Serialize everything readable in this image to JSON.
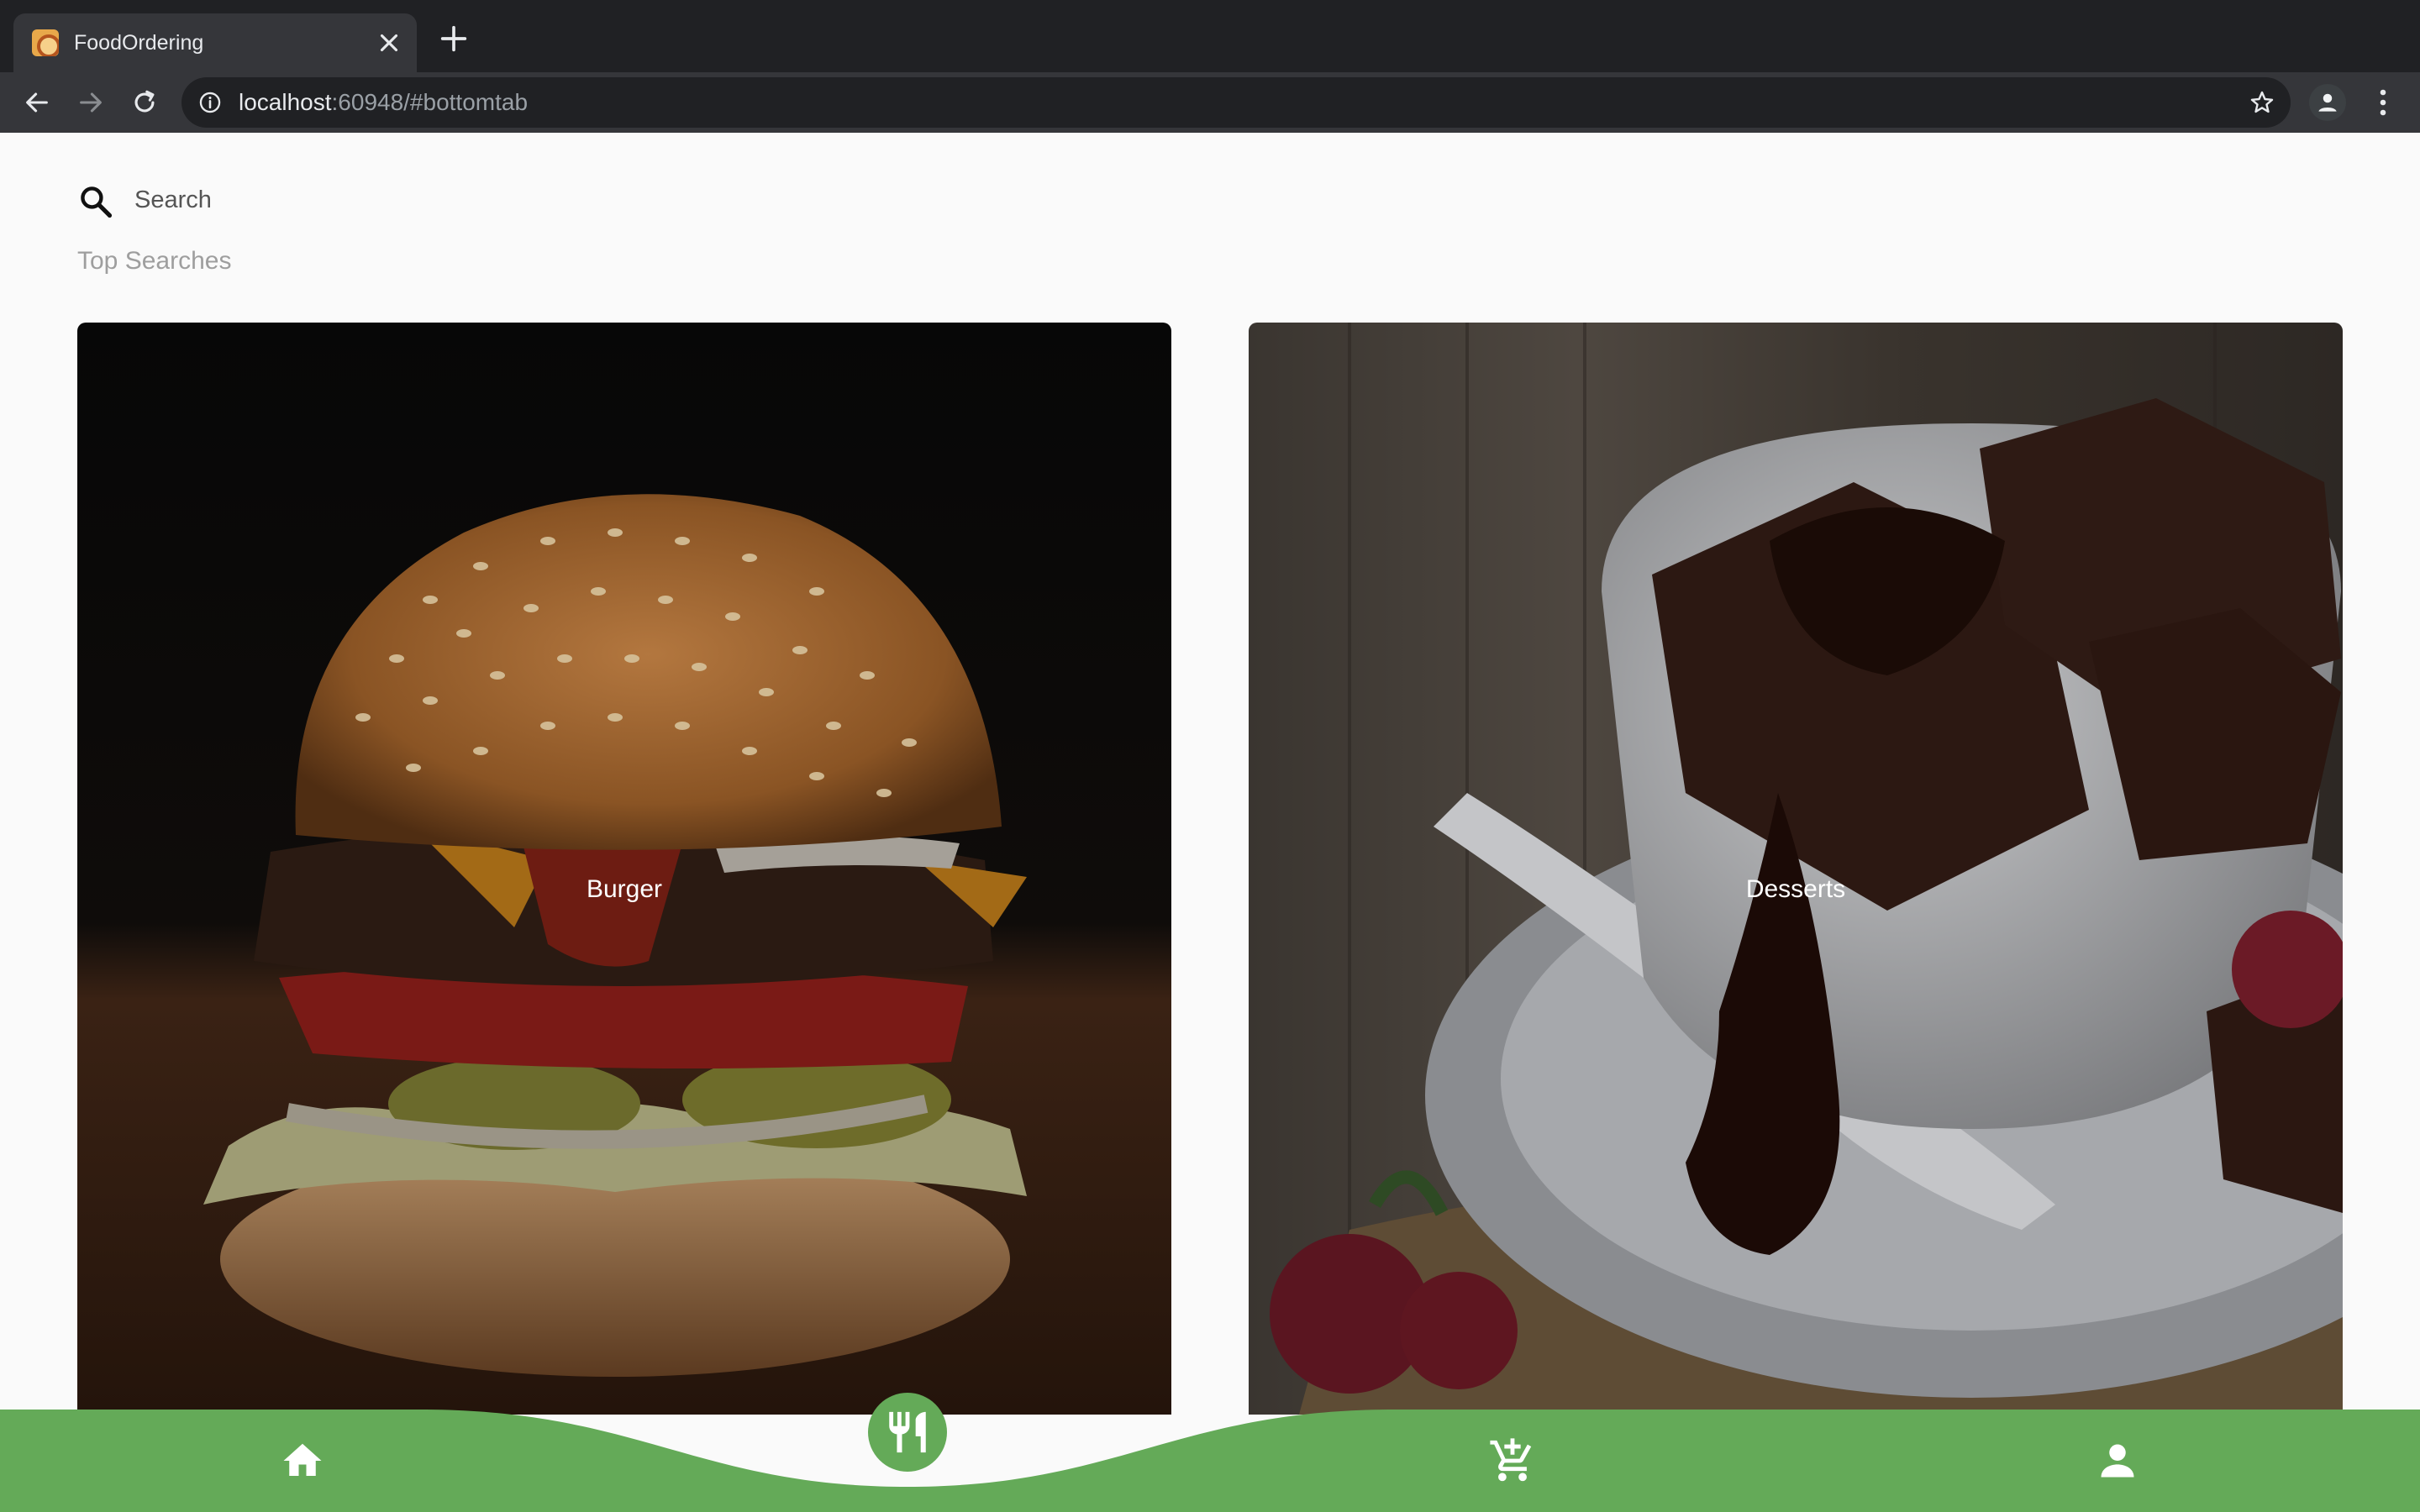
{
  "browser": {
    "tab_title": "FoodOrdering",
    "url_host": "localhost",
    "url_rest": ":60948/#bottomtab"
  },
  "search": {
    "placeholder": "Search",
    "section_title": "Top Searches"
  },
  "categories": [
    {
      "label": "Burger",
      "image": "burger-photo"
    },
    {
      "label": "Desserts",
      "image": "brownies-cup-photo"
    }
  ],
  "bottom_nav": {
    "accent_color": "#64aa58",
    "items": [
      {
        "icon": "home-icon"
      },
      {
        "icon": "restaurant-icon",
        "active": true
      },
      {
        "icon": "add-cart-icon"
      },
      {
        "icon": "person-icon"
      }
    ]
  }
}
